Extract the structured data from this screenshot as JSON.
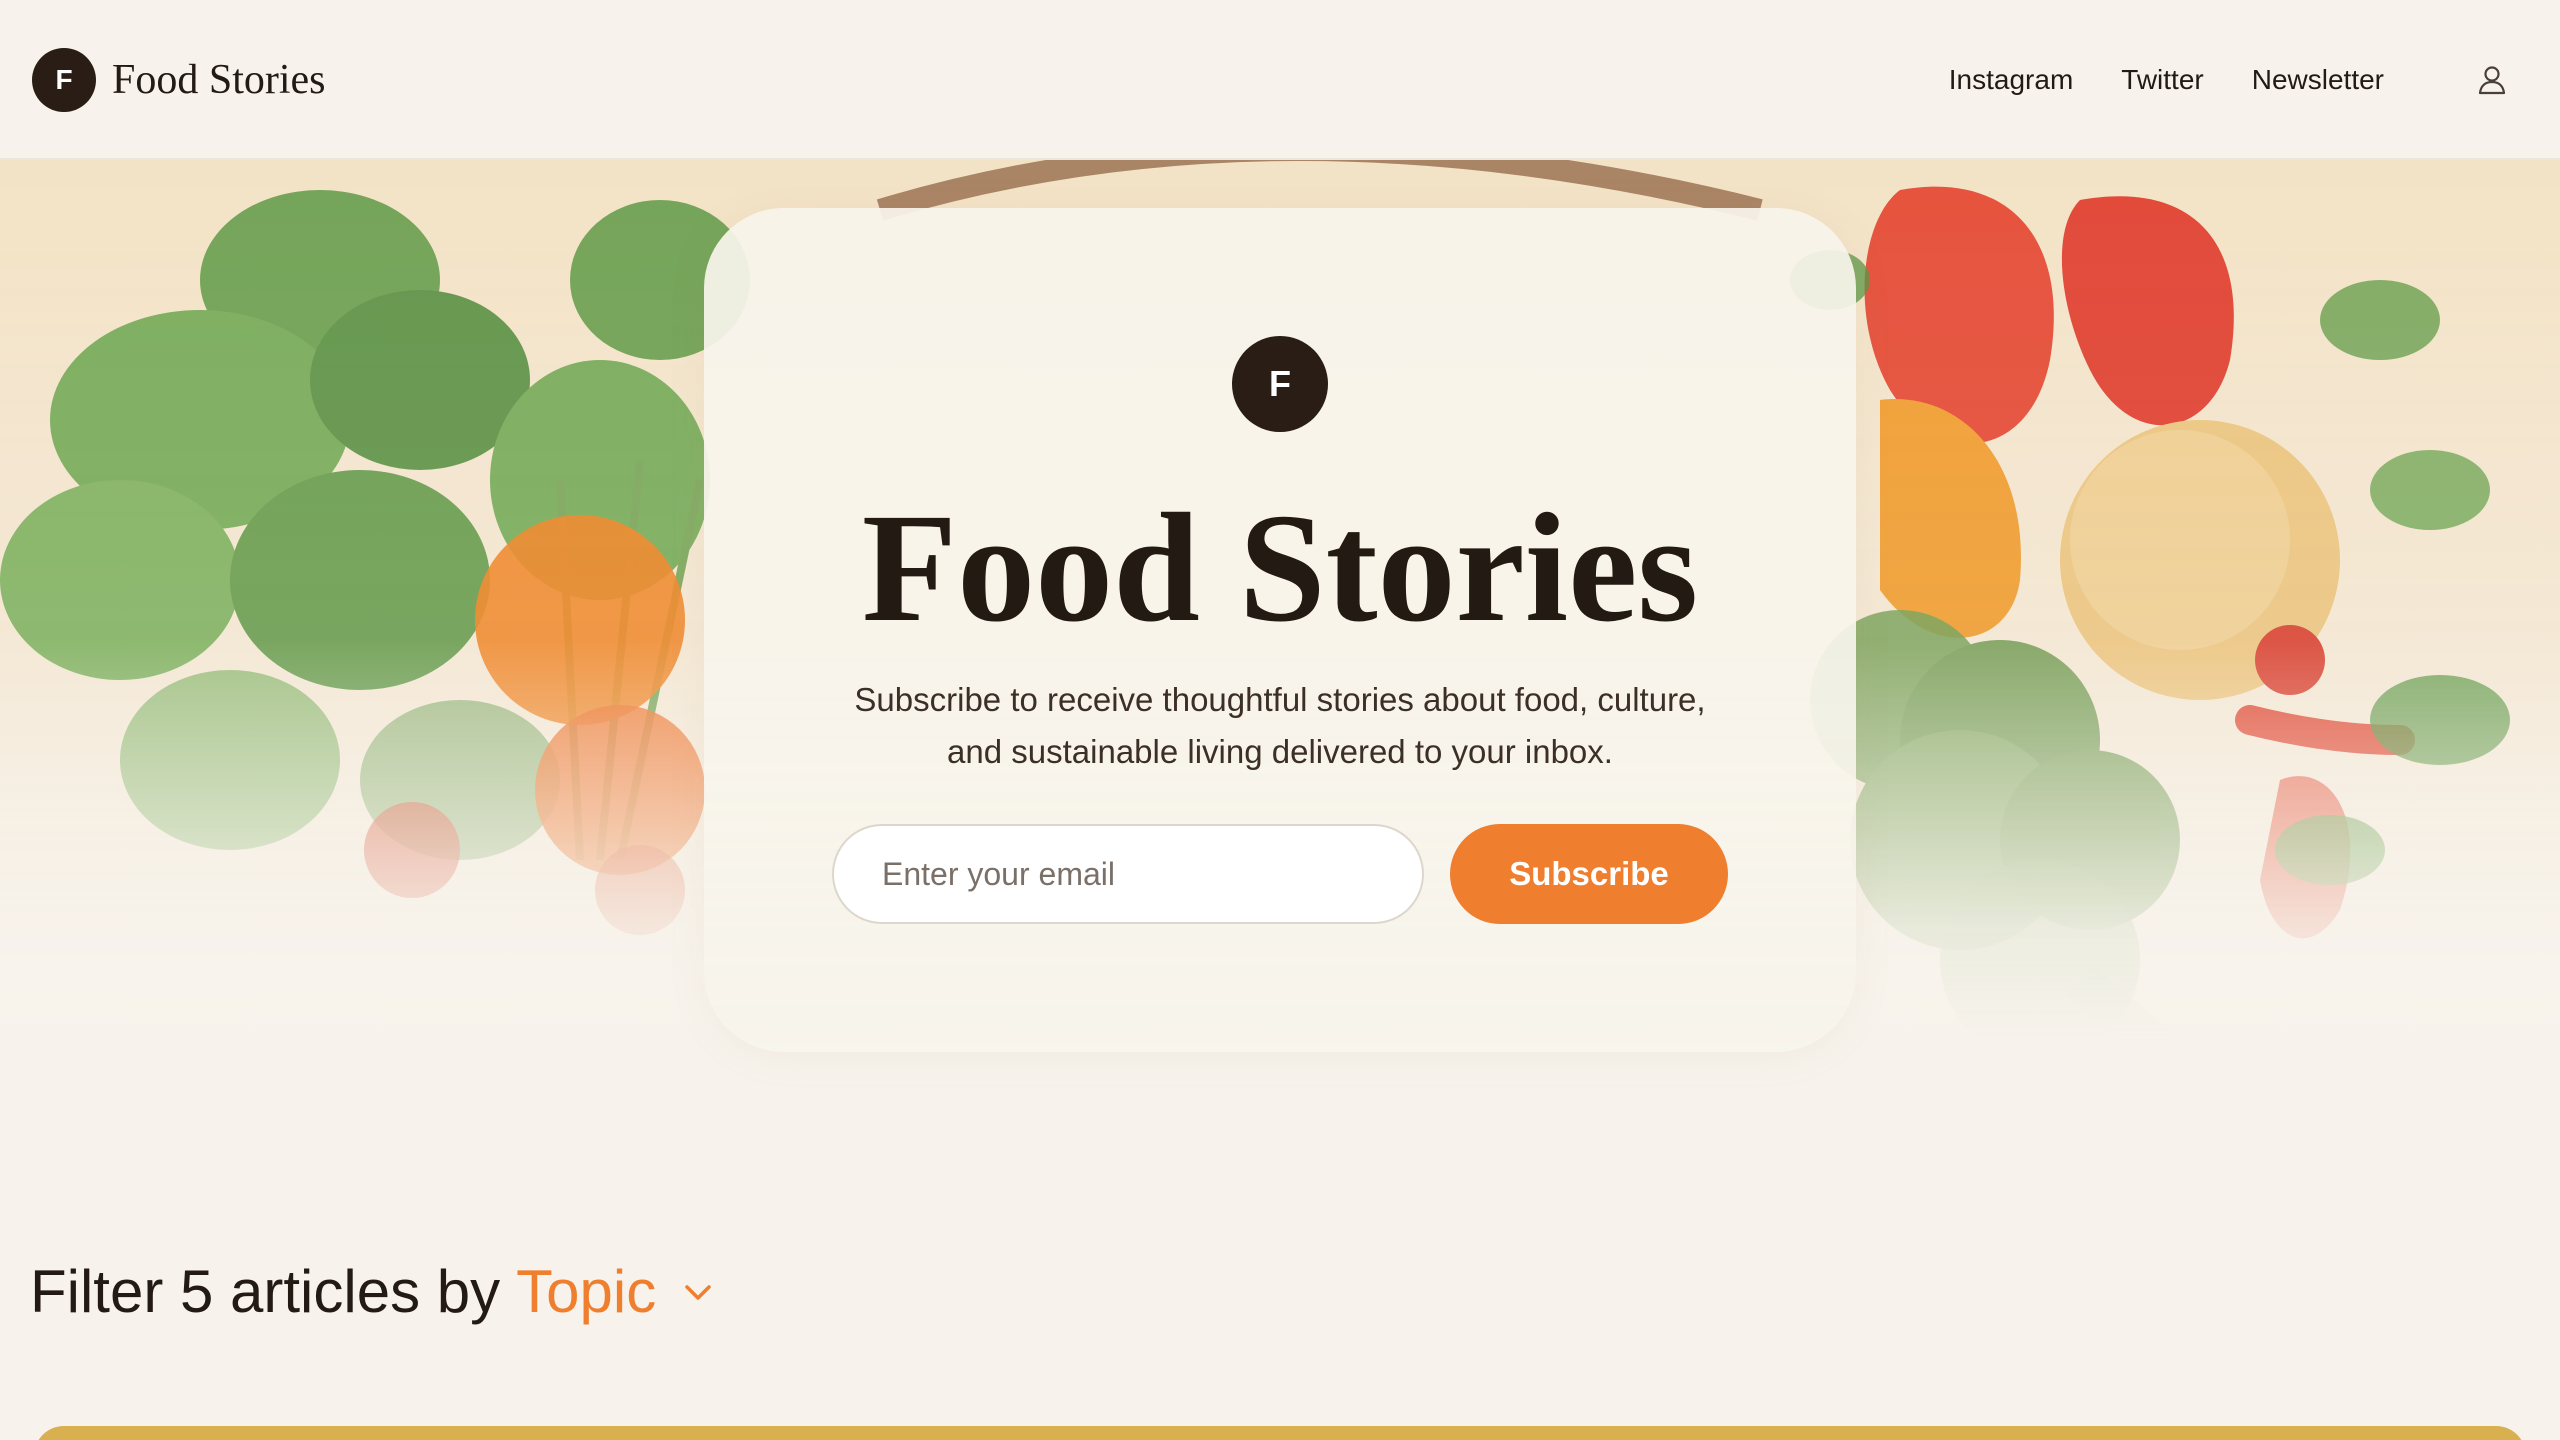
{
  "header": {
    "logo_letter": "F",
    "brand": "Food Stories",
    "nav": [
      "Instagram",
      "Twitter",
      "Newsletter"
    ],
    "user_icon": "user-icon"
  },
  "hero": {
    "logo_letter": "F",
    "title": "Food Stories",
    "subtitle_line1": "Subscribe to receive thoughtful stories about food, culture,",
    "subtitle_line2": "and sustainable living delivered to your inbox.",
    "email_placeholder": "Enter your email",
    "subscribe_label": "Subscribe"
  },
  "filter": {
    "prefix": "Filter 5 articles by",
    "topic": "Topic",
    "chevron_icon": "chevron-down-icon"
  },
  "colors": {
    "accent": "#ef7e2e",
    "dark": "#2a1d16",
    "background": "#f7f3ec",
    "strip": "#d9b04f"
  }
}
